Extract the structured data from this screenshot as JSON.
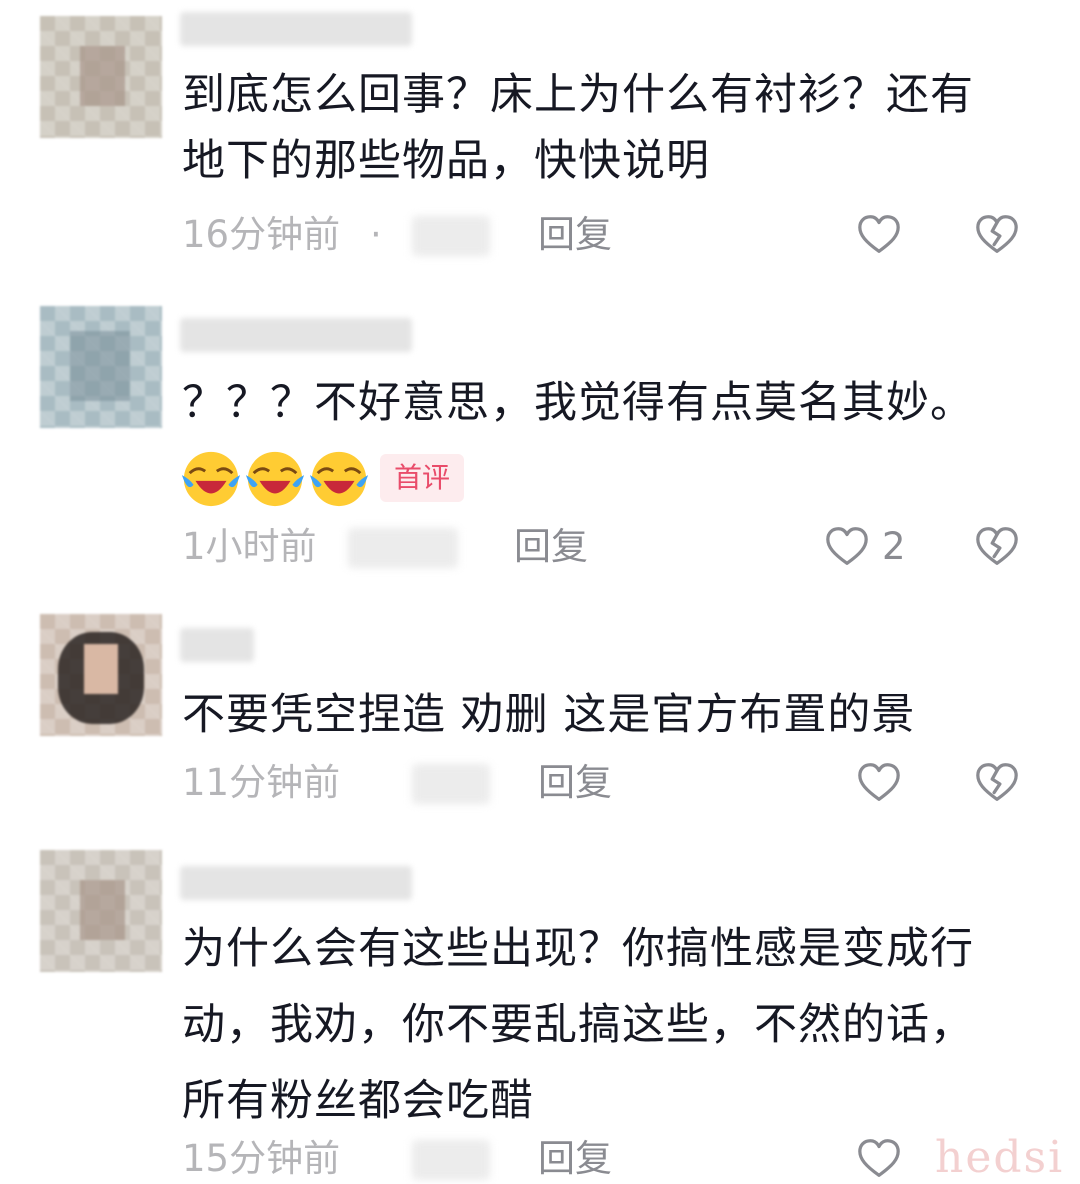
{
  "comments": [
    {
      "text_lines": [
        "到底怎么回事？床上为什么有衬衫？还有",
        "地下的那些物品，快快说明"
      ],
      "time": "16分钟前",
      "separator": "·",
      "reply_label": "回复",
      "like_icon": "heart-outline-icon",
      "dislike_icon": "broken-heart-icon"
    },
    {
      "text_lines": [
        "？？？不好意思，我觉得有点莫名其妙。"
      ],
      "emojis": [
        "crying-laughing-emoji",
        "crying-laughing-emoji",
        "crying-laughing-emoji"
      ],
      "badge": "首评",
      "time": "1小时前",
      "reply_label": "回复",
      "like_count": "2",
      "like_icon": "heart-outline-icon",
      "dislike_icon": "broken-heart-icon"
    },
    {
      "text_lines": [
        "不要凭空捏造 劝删 这是官方布置的景"
      ],
      "time": "11分钟前",
      "reply_label": "回复",
      "like_icon": "heart-outline-icon",
      "dislike_icon": "broken-heart-icon"
    },
    {
      "text_lines": [
        "为什么会有这些出现？你搞性感是变成行",
        "动，我劝，你不要乱搞这些，不然的话，",
        "所有粉丝都会吃醋"
      ],
      "time": "15分钟前",
      "reply_label": "回复",
      "like_icon": "heart-outline-icon",
      "dislike_icon": "broken-heart-icon"
    }
  ],
  "watermark": "hedsi",
  "colors": {
    "text": "#161823",
    "meta": "#b5b5b8",
    "reply": "#8a8b91",
    "badge_bg": "#fdecee",
    "badge_text": "#e94c6a"
  }
}
